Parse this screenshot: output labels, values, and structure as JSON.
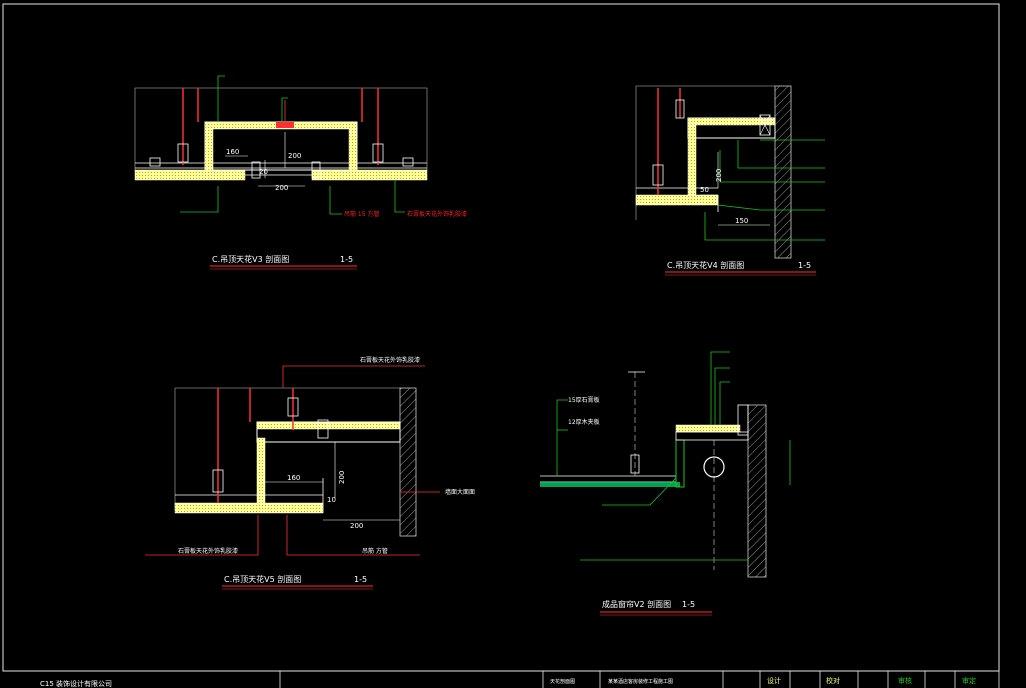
{
  "colors": {
    "background": "#000000",
    "frame": "#e6e6e6",
    "leader_red": "#ff2020",
    "leader_green": "#19c819",
    "fill_yellow": "#ffff99",
    "fill_green": "#00cc66",
    "hanger_red": "#ff3030",
    "wall_hatch": "#cccccc",
    "title_underline": "#ff3030"
  },
  "details": {
    "v3": {
      "title": "C.吊顶天花V3 剖面图",
      "scale": "1-5",
      "dims": [
        "160",
        "20",
        "200",
        "200"
      ],
      "labels": [
        "吊筋 15 方管",
        "石膏板天花外饰乳胶漆"
      ]
    },
    "v4": {
      "title": "C.吊顶天花V4 剖面图",
      "scale": "1-5",
      "dims": [
        "200",
        "50",
        "150"
      ]
    },
    "v5": {
      "title": "C.吊顶天花V5 剖面图",
      "scale": "1-5",
      "dims": [
        "160",
        "200",
        "10",
        "200"
      ],
      "labels": [
        "石膏板天花外饰乳胶漆",
        "墙面大面面",
        "石膏板天花外饰乳胶漆",
        "吊筋  方管"
      ]
    },
    "v2": {
      "title": "成品窗帘V2 剖面图",
      "scale": "1-5",
      "labels": [
        "15厚石膏板",
        "12厚木夹板"
      ]
    }
  },
  "title_block": {
    "company": "C15 装饰设计有限公司",
    "drawing_name": "天花剖面图",
    "project": "某某酒店客房装修工程施工图",
    "signatures": [
      "设计",
      "校对",
      "审核",
      "审定"
    ]
  }
}
